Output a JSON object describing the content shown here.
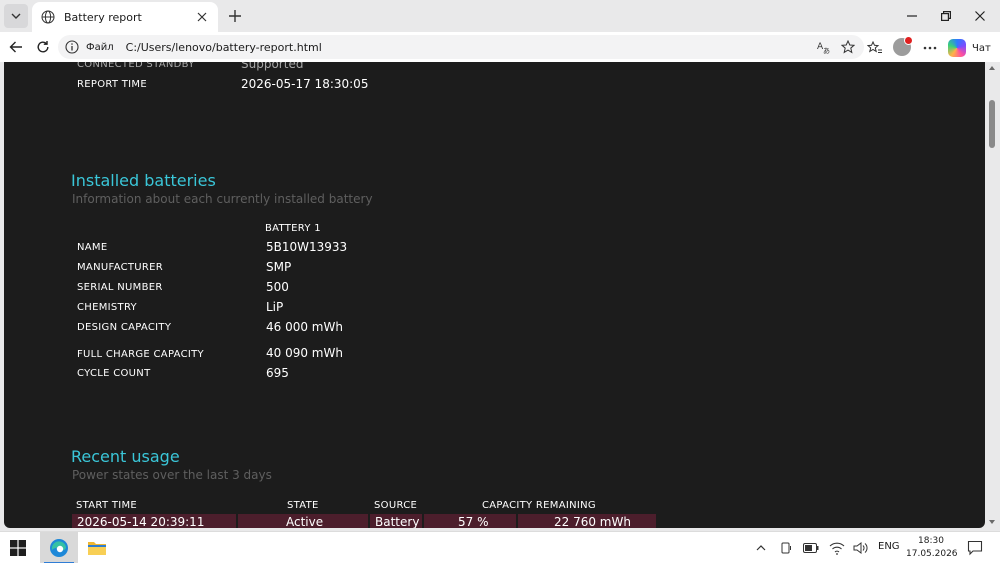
{
  "browser": {
    "tab_title": "Battery report",
    "address_scheme": "Файл",
    "address_url": "C:/Users/lenovo/battery-report.html",
    "copilot_label": "Чат"
  },
  "report": {
    "top_rows": [
      {
        "label": "CONNECTED STANDBY",
        "value": "Supported"
      },
      {
        "label": "REPORT TIME",
        "value": "2026-05-17  18:30:05"
      }
    ],
    "installed": {
      "title": "Installed batteries",
      "subtitle": "Information about each currently installed battery",
      "column_header": "BATTERY 1",
      "rows": [
        {
          "label": "NAME",
          "value": "5B10W13933"
        },
        {
          "label": "MANUFACTURER",
          "value": "SMP"
        },
        {
          "label": "SERIAL NUMBER",
          "value": "500"
        },
        {
          "label": "CHEMISTRY",
          "value": "LiP"
        },
        {
          "label": "DESIGN CAPACITY",
          "value": "46 000 mWh"
        },
        {
          "label": "FULL CHARGE CAPACITY",
          "value": "40 090 mWh"
        },
        {
          "label": "CYCLE COUNT",
          "value": "695"
        }
      ]
    },
    "usage": {
      "title": "Recent usage",
      "subtitle": "Power states over the last 3 days",
      "headers": [
        "START TIME",
        "STATE",
        "SOURCE",
        "CAPACITY REMAINING"
      ],
      "first_row": {
        "start_time": "2026-05-14  20:39:11",
        "state": "Active",
        "source": "Battery",
        "percent": "57 %",
        "mwh": "22 760 mWh"
      }
    }
  },
  "taskbar": {
    "language": "ENG",
    "time": "18:30",
    "date": "17.05.2026"
  }
}
